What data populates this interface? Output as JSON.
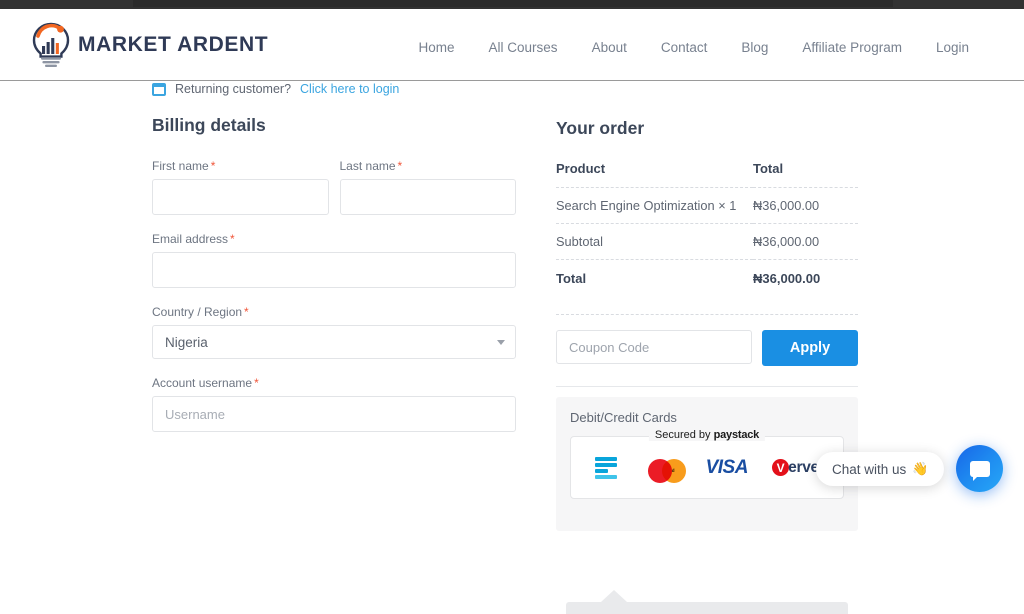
{
  "header": {
    "brand": "MARKET ARDENT",
    "nav": [
      {
        "label": "Home"
      },
      {
        "label": "All Courses"
      },
      {
        "label": "About"
      },
      {
        "label": "Contact"
      },
      {
        "label": "Blog"
      },
      {
        "label": "Affiliate Program"
      },
      {
        "label": "Login"
      }
    ]
  },
  "notice": {
    "text": "Returning customer?",
    "link": "Click here to login",
    "link_color": "#3ba5e0"
  },
  "billing": {
    "title": "Billing details",
    "first_name": {
      "label": "First name",
      "required": "*",
      "value": "",
      "placeholder": ""
    },
    "last_name": {
      "label": "Last name",
      "required": "*",
      "value": "",
      "placeholder": ""
    },
    "email": {
      "label": "Email address",
      "required": "*",
      "value": "",
      "placeholder": ""
    },
    "country": {
      "label": "Country / Region",
      "required": "*",
      "value": "Nigeria"
    },
    "username": {
      "label": "Account username",
      "required": "*",
      "value": "",
      "placeholder": "Username"
    }
  },
  "order": {
    "title": "Your order",
    "columns": {
      "product": "Product",
      "total": "Total"
    },
    "rows": [
      {
        "name": "Search Engine Optimization",
        "qty": "× 1",
        "amount": "₦36,000.00"
      }
    ],
    "subtotal": {
      "label": "Subtotal",
      "amount": "₦36,000.00"
    },
    "total": {
      "label": "Total",
      "amount": "₦36,000.00"
    }
  },
  "coupon": {
    "placeholder": "Coupon Code",
    "value": "",
    "apply_label": "Apply",
    "apply_color": "#1a8fe3"
  },
  "payment": {
    "method_label": "Debit/Credit Cards",
    "secured_prefix": "Secured by",
    "secured_brand": "paystack",
    "cards": [
      {
        "name": "paystack-card",
        "label": ""
      },
      {
        "name": "mastercard",
        "label": "mastercard"
      },
      {
        "name": "visa",
        "label": "VISA"
      },
      {
        "name": "verve",
        "label": "erve",
        "mark": "V"
      }
    ]
  },
  "chat": {
    "text": "Chat with us",
    "emoji": "👋"
  }
}
